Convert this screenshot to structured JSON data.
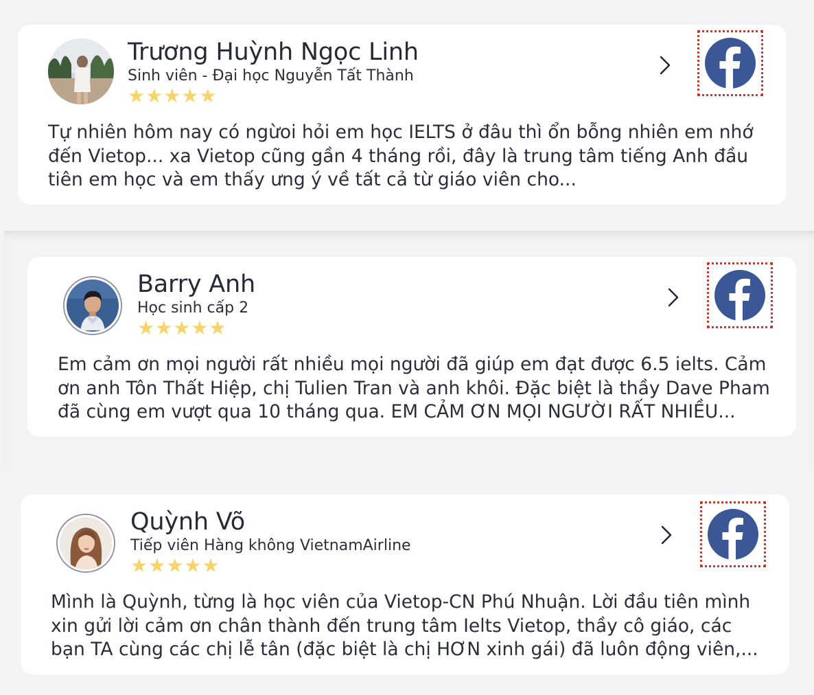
{
  "reviews": [
    {
      "name": "Trương Huỳnh Ngọc Linh",
      "role": "Sinh viên - Đại học Nguyễn Tất Thành",
      "stars": "★★★★★",
      "text": "Tự nhiên hôm nay có ngừoi hỏi em học IELTS ở đâu thì ổn bỗng nhiên em nhớ\nđến Vietop... xa Vietop cũng gần 4 tháng rồi, đây là trung tâm tiếng Anh đầu\ntiên em học và em thấy ưng ý về tất cả từ giáo viên cho..."
    },
    {
      "name": "Barry Anh",
      "role": "Học sinh cấp 2",
      "stars": "★★★★★",
      "text": "Em cảm ơn mọi người rất nhiều mọi người đã giúp em đạt được 6.5 ielts. Cảm\nơn anh Tôn Thất Hiệp, chị Tulien Tran và anh khôi. Đặc biệt là thầy Dave Pham\nđã cùng em vượt qua 10 tháng qua. EM CẢM ƠN MỌI NGƯỜI RẤT NHIỀU..."
    },
    {
      "name": "Quỳnh Võ",
      "role": "Tiếp viên Hàng không VietnamAirline",
      "stars": "★★★★★",
      "text": "Mình là Quỳnh, từng là học viên của Vietop-CN Phú Nhuận. Lời đầu tiên mình\nxin gửi lời cảm ơn chân thành đến trung tâm Ielts Vietop, thầy cô giáo, các\nbạn TA cùng các chị lễ tân (đặc biệt là chị HƠN xinh gái) đã luôn động viên,..."
    }
  ],
  "colors": {
    "star": "#f7d469",
    "facebook": "#3b5795",
    "highlight_border": "#d9301f",
    "background": "#f3f3f5"
  },
  "icons": {
    "next": "chevron-right-icon",
    "social": "facebook-icon"
  }
}
